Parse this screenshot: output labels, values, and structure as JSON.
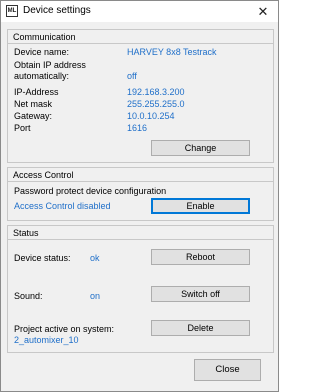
{
  "window": {
    "title": "Device settings",
    "icon_text": "ML",
    "close_glyph": "✕"
  },
  "communication": {
    "title": "Communication",
    "device_name_label": "Device name:",
    "device_name_value": "HARVEY 8x8 Testrack",
    "obtain_ip_label_line1": "Obtain IP address",
    "obtain_ip_label_line2": "automatically:",
    "obtain_ip_value": "off",
    "ip_label": "IP-Address",
    "ip_value": "192.168.3.200",
    "netmask_label": "Net mask",
    "netmask_value": "255.255.255.0",
    "gateway_label": "Gateway:",
    "gateway_value": "10.0.10.254",
    "port_label": "Port",
    "port_value": "1616",
    "change_button": "Change"
  },
  "access_control": {
    "title": "Access Control",
    "description": "Password protect device configuration",
    "state_text": "Access Control disabled",
    "enable_button": "Enable"
  },
  "status": {
    "title": "Status",
    "device_status_label": "Device status:",
    "device_status_value": "ok",
    "reboot_button": "Reboot",
    "sound_label": "Sound:",
    "sound_value": "on",
    "switch_off_button": "Switch off",
    "project_label": "Project active on system:",
    "project_value": "2_automixer_10",
    "delete_button": "Delete"
  },
  "footer": {
    "close_button": "Close"
  },
  "colors": {
    "accent": "#1f6fc9",
    "focus": "#0078d7"
  }
}
